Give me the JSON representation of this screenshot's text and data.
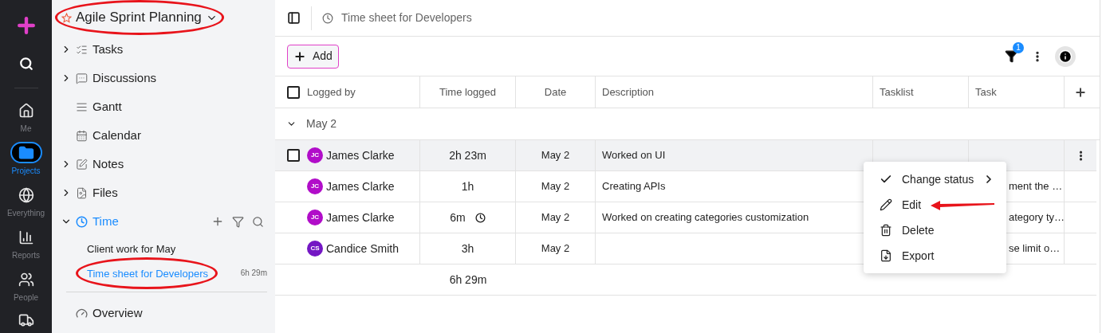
{
  "rail": {
    "items": [
      {
        "label": "Me",
        "selected": false
      },
      {
        "label": "Projects",
        "selected": true
      },
      {
        "label": "Everything",
        "selected": false
      },
      {
        "label": "Reports",
        "selected": false
      },
      {
        "label": "People",
        "selected": false
      }
    ]
  },
  "sidebar": {
    "project": {
      "title": "Agile Sprint Planning",
      "circled": true
    },
    "items": [
      {
        "label": "Tasks",
        "expanded": false,
        "selected": false
      },
      {
        "label": "Discussions",
        "expanded": false,
        "selected": false
      },
      {
        "label": "Gantt",
        "selected": false
      },
      {
        "label": "Calendar",
        "selected": false
      },
      {
        "label": "Notes",
        "expanded": false,
        "selected": false
      },
      {
        "label": "Files",
        "expanded": false,
        "selected": false
      },
      {
        "label": "Time",
        "expanded": true,
        "selected": true,
        "children": [
          {
            "label": "Client work for May",
            "selected": false,
            "circled": false
          },
          {
            "label": "Time sheet for Developers",
            "selected": true,
            "circled": true,
            "total": "6h 29m"
          }
        ]
      }
    ],
    "bottom_item": {
      "label": "Overview"
    }
  },
  "header": {
    "breadcrumb": "Time sheet for Developers"
  },
  "toolbar": {
    "add_button": "Add",
    "filter_count": "1"
  },
  "table": {
    "columns": [
      "Logged by",
      "Time logged",
      "Date",
      "Description",
      "Tasklist",
      "Task"
    ],
    "select_all_checked": false,
    "group": {
      "label": "May 2",
      "expanded": true
    },
    "rows": [
      {
        "logged_by": "James Clarke",
        "initials": "JC",
        "color": "#b10dc9",
        "time": "2h 23m",
        "timer": false,
        "date": "May 2",
        "description": "Worked on UI",
        "task": "",
        "hovered": true,
        "checked": false
      },
      {
        "logged_by": "James Clarke",
        "initials": "JC",
        "color": "#b10dc9",
        "time": "1h",
        "timer": false,
        "date": "May 2",
        "description": "Creating APIs",
        "task": "ment the …",
        "hovered": false,
        "checked": false
      },
      {
        "logged_by": "James Clarke",
        "initials": "JC",
        "color": "#b10dc9",
        "time": "6m",
        "timer": true,
        "date": "May 2",
        "description": "Worked on creating categories customization",
        "task": "ategory ty…",
        "hovered": false,
        "checked": false
      },
      {
        "logged_by": "Candice Smith",
        "initials": "CS",
        "color": "#7417c4",
        "time": "3h",
        "timer": false,
        "date": "May 2",
        "description": "",
        "task": "se limit o…",
        "hovered": false,
        "checked": false
      }
    ],
    "total": "6h 29m"
  },
  "context_menu": {
    "items": [
      {
        "label": "Change status",
        "submenu": true,
        "arrow": false
      },
      {
        "label": "Edit",
        "submenu": false,
        "arrow": true
      },
      {
        "label": "Delete",
        "submenu": false,
        "arrow": false
      },
      {
        "label": "Export",
        "submenu": false,
        "arrow": false
      }
    ]
  }
}
